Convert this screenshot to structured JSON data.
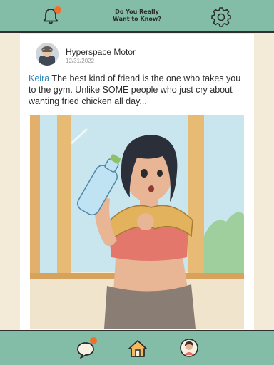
{
  "header": {
    "title": "Do You Really\nWant to Know?",
    "bell_icon": "bell-icon",
    "settings_icon": "gear-icon",
    "notification_color": "#f26e2b"
  },
  "post": {
    "author": "Hyperspace Motor",
    "date": "12/31/2022",
    "mention": "Keira",
    "text": " The best kind of friend is the one who takes you to the gym. Unlike SOME people who just cry about wanting fried chicken all day...",
    "image": "illustration of a woman with short black hair, towel around neck, drinking from a water bottle at the gym"
  },
  "nav": {
    "items": [
      {
        "name": "chat",
        "icon": "chat-bubble-icon",
        "has_badge": true
      },
      {
        "name": "home",
        "icon": "home-icon"
      },
      {
        "name": "profile",
        "icon": "profile-avatar-icon"
      }
    ]
  },
  "colors": {
    "bar": "#83bda8",
    "background": "#f3ead8",
    "link": "#2c86b8"
  }
}
